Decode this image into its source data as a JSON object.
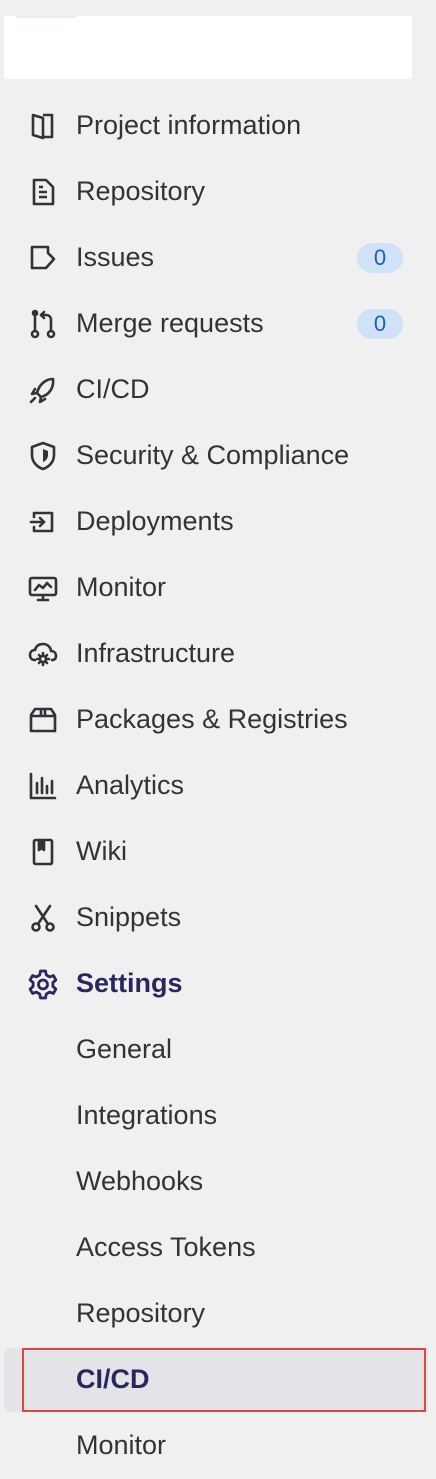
{
  "sidebar": {
    "items": [
      {
        "label": "Project information",
        "icon": "project-information-icon"
      },
      {
        "label": "Repository",
        "icon": "repository-document-icon"
      },
      {
        "label": "Issues",
        "icon": "issues-icon",
        "badge": "0"
      },
      {
        "label": "Merge requests",
        "icon": "merge-request-icon",
        "badge": "0"
      },
      {
        "label": "CI/CD",
        "icon": "rocket-icon"
      },
      {
        "label": "Security & Compliance",
        "icon": "shield-icon"
      },
      {
        "label": "Deployments",
        "icon": "deployments-icon"
      },
      {
        "label": "Monitor",
        "icon": "monitor-icon"
      },
      {
        "label": "Infrastructure",
        "icon": "cloud-gear-icon"
      },
      {
        "label": "Packages & Registries",
        "icon": "package-icon"
      },
      {
        "label": "Analytics",
        "icon": "chart-icon"
      },
      {
        "label": "Wiki",
        "icon": "book-icon"
      },
      {
        "label": "Snippets",
        "icon": "scissors-icon"
      },
      {
        "label": "Settings",
        "icon": "gear-icon",
        "active": true
      }
    ],
    "settings_sub_items": [
      {
        "label": "General"
      },
      {
        "label": "Integrations"
      },
      {
        "label": "Webhooks"
      },
      {
        "label": "Access Tokens"
      },
      {
        "label": "Repository"
      },
      {
        "label": "CI/CD",
        "current": true
      },
      {
        "label": "Monitor"
      }
    ]
  },
  "colors": {
    "sidebar_bg": "#f0f0f0",
    "active_text": "#28285e",
    "badge_bg": "#cfe2f7",
    "badge_text": "#1f5fad",
    "highlight_outline": "#e0453a",
    "current_row_bg": "#e3e3e8"
  }
}
